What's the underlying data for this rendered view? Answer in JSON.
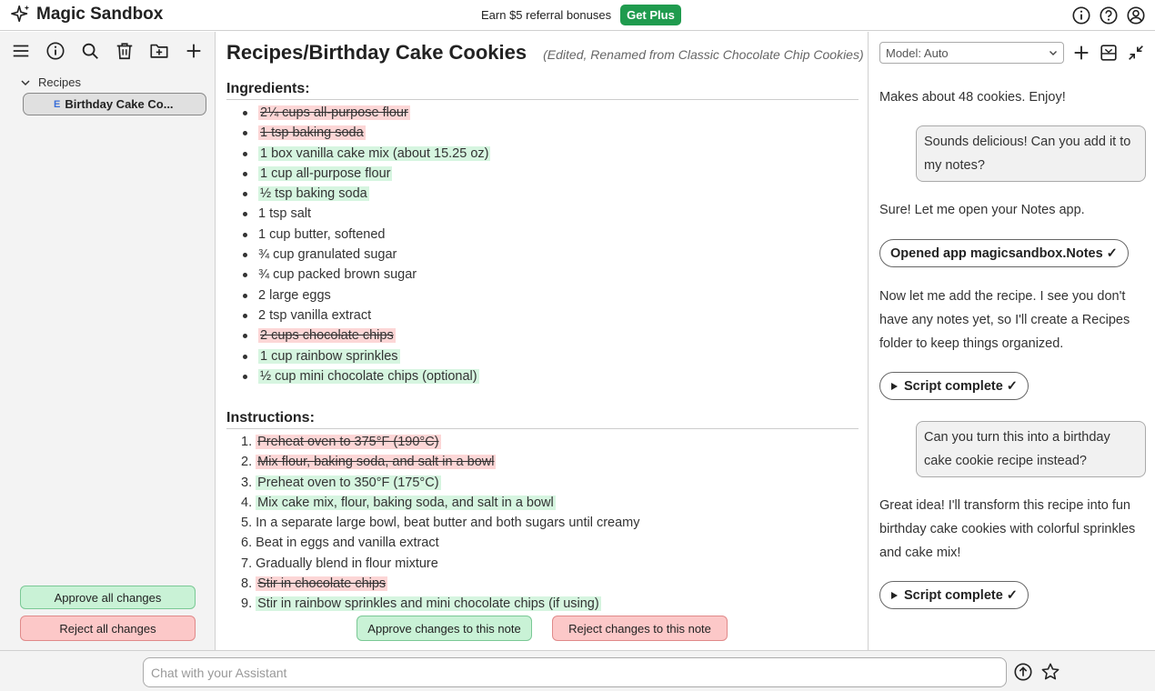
{
  "app": {
    "title": "Magic Sandbox"
  },
  "promo": {
    "text": "Earn $5 referral bonuses",
    "button": "Get Plus"
  },
  "sidebar": {
    "folder": "Recipes",
    "note_flag": "E",
    "note_label": "Birthday Cake Co...",
    "approve_all": "Approve all changes",
    "reject_all": "Reject all changes"
  },
  "note": {
    "title": "Recipes/Birthday Cake Cookies",
    "subtitle": "(Edited, Renamed from Classic Chocolate Chip Cookies)",
    "ingredients_heading": "Ingredients:",
    "ingredients": [
      {
        "text": "2¼ cups all-purpose flour",
        "status": "deleted"
      },
      {
        "text": "1 tsp baking soda",
        "status": "deleted"
      },
      {
        "text": "1 box vanilla cake mix (about 15.25 oz)",
        "status": "added"
      },
      {
        "text": "1 cup all-purpose flour",
        "status": "added"
      },
      {
        "text": "½ tsp baking soda",
        "status": "added"
      },
      {
        "text": "1 tsp salt",
        "status": "unchanged"
      },
      {
        "text": "1 cup butter, softened",
        "status": "unchanged"
      },
      {
        "text": "¾ cup granulated sugar",
        "status": "unchanged"
      },
      {
        "text": "¾ cup packed brown sugar",
        "status": "unchanged"
      },
      {
        "text": "2 large eggs",
        "status": "unchanged"
      },
      {
        "text": "2 tsp vanilla extract",
        "status": "unchanged"
      },
      {
        "text": "2 cups chocolate chips",
        "status": "deleted"
      },
      {
        "text": "1 cup rainbow sprinkles",
        "status": "added"
      },
      {
        "text": "½ cup mini chocolate chips (optional)",
        "status": "added"
      }
    ],
    "instructions_heading": "Instructions:",
    "instructions": [
      {
        "num": "1.",
        "text": "Preheat oven to 375°F (190°C)",
        "status": "deleted"
      },
      {
        "num": "2.",
        "text": "Mix flour, baking soda, and salt in a bowl",
        "status": "deleted"
      },
      {
        "num": "3.",
        "text": "Preheat oven to 350°F (175°C)",
        "status": "added"
      },
      {
        "num": "4.",
        "text": "Mix cake mix, flour, baking soda, and salt in a bowl",
        "status": "added"
      },
      {
        "num": "5.",
        "text": "In a separate large bowl, beat butter and both sugars until creamy",
        "status": "unchanged"
      },
      {
        "num": "6.",
        "text": "Beat in eggs and vanilla extract",
        "status": "unchanged"
      },
      {
        "num": "7.",
        "text": "Gradually blend in flour mixture",
        "status": "unchanged"
      },
      {
        "num": "8.",
        "text": "Stir in chocolate chips",
        "status": "deleted"
      },
      {
        "num": "9.",
        "text": "Stir in rainbow sprinkles and mini chocolate chips (if using)",
        "status": "added"
      }
    ],
    "approve_note": "Approve changes to this note",
    "reject_note": "Reject changes to this note"
  },
  "chat": {
    "model_label": "Model: Auto",
    "messages": {
      "m1": "Makes about 48 cookies. Enjoy!",
      "u1": "Sounds delicious! Can you add it to my notes?",
      "m2": "Sure! Let me open your Notes app.",
      "p1": "Opened app magicsandbox.Notes ✓",
      "m3": "Now let me add the recipe. I see you don't have any notes yet, so I'll create a Recipes folder to keep things organized.",
      "p2": "Script complete ✓",
      "u2": "Can you turn this into a birthday cake cookie recipe instead?",
      "m4": "Great idea! I'll transform this recipe into fun birthday cake cookies with colorful sprinkles and cake mix!",
      "p3": "Script complete ✓"
    },
    "input_placeholder": "Chat with your Assistant"
  },
  "colors": {
    "added_bg": "#d6f5e0",
    "deleted_bg": "#fcd6d6",
    "get_plus": "#1f9b4e"
  },
  "icons": [
    "sparkle-icon",
    "info-icon",
    "help-icon",
    "account-icon",
    "menu-icon",
    "search-icon",
    "trash-icon",
    "new-folder-icon",
    "plus-icon",
    "chevron-down-icon",
    "save-icon",
    "collapse-icon",
    "send-icon",
    "star-icon",
    "play-icon"
  ]
}
